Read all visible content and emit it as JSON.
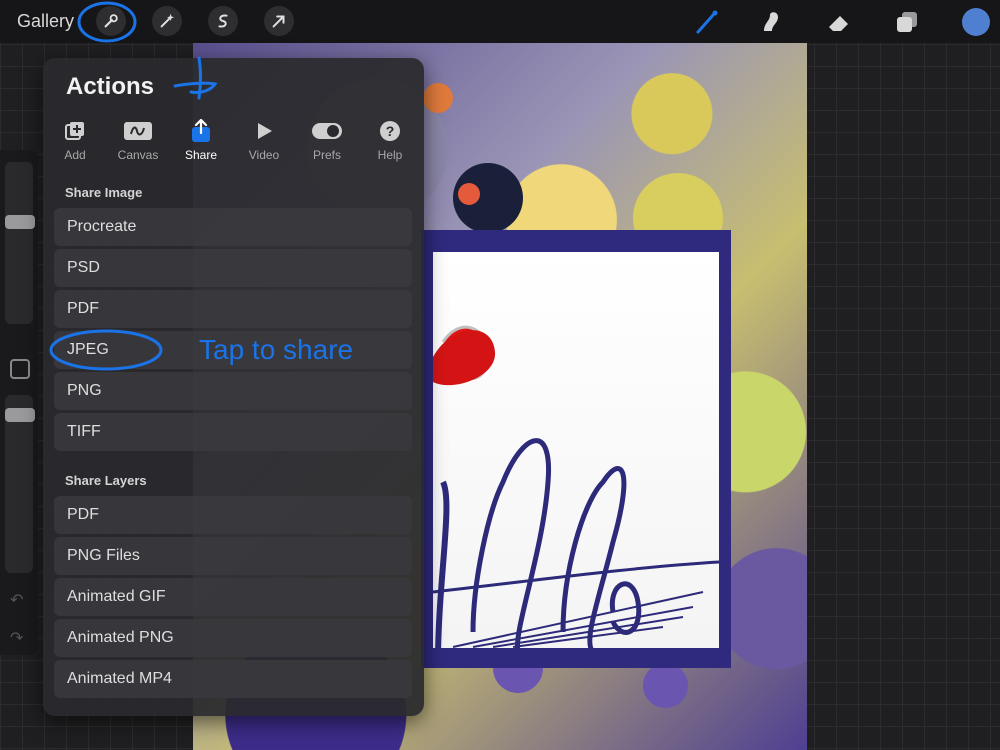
{
  "topbar": {
    "gallery_label": "Gallery",
    "left_tools": [
      "wrench-icon",
      "magic-wand-icon",
      "selection-s-icon",
      "transform-arrow-icon"
    ],
    "right_tools": [
      "brush-icon",
      "smudge-icon",
      "eraser-icon",
      "layers-icon"
    ],
    "active_color": "#4f7fd0",
    "accent": "#1a74e8"
  },
  "actions": {
    "title": "Actions",
    "tabs": [
      {
        "label": "Add",
        "icon": "add-image-icon"
      },
      {
        "label": "Canvas",
        "icon": "canvas-icon"
      },
      {
        "label": "Share",
        "icon": "share-icon"
      },
      {
        "label": "Video",
        "icon": "play-icon"
      },
      {
        "label": "Prefs",
        "icon": "toggle-icon"
      },
      {
        "label": "Help",
        "icon": "help-icon"
      }
    ],
    "active_tab": "Share",
    "share_image_header": "Share Image",
    "share_image_items": [
      "Procreate",
      "PSD",
      "PDF",
      "JPEG",
      "PNG",
      "TIFF"
    ],
    "share_layers_header": "Share Layers",
    "share_layers_items": [
      "PDF",
      "PNG Files",
      "Animated GIF",
      "Animated PNG",
      "Animated MP4"
    ]
  },
  "annotations": {
    "tap_to_share": "Tap to share"
  }
}
